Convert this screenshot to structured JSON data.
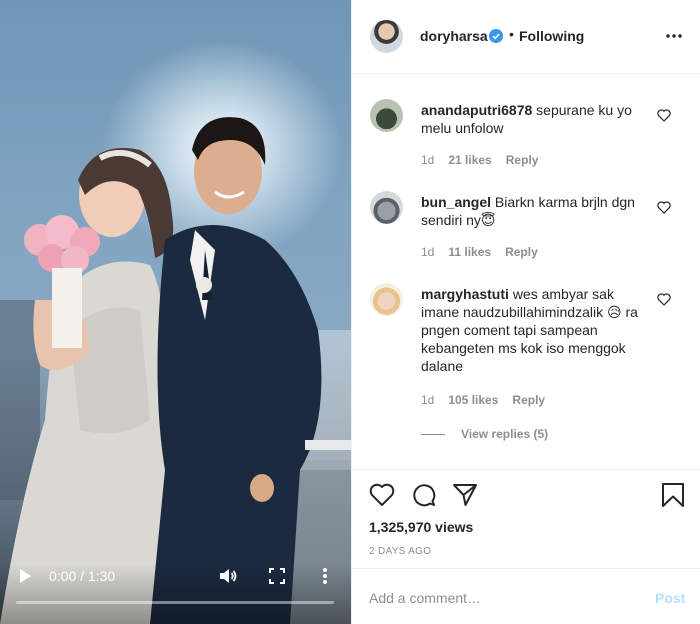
{
  "post": {
    "author": "doryharsa",
    "separator": "•",
    "follow_status": "Following",
    "views": "1,325,970 views",
    "date": "2 DAYS AGO"
  },
  "video": {
    "time": "0:00 / 1:30",
    "progress": 0
  },
  "comments": [
    {
      "username": "anandaputri6878",
      "text": "sepurane ku yo melu unfolow",
      "age": "1d",
      "likes": "21 likes",
      "reply": "Reply"
    },
    {
      "username": "bun_angel",
      "text": "Biarkn karma brjln dgn sendiri ny😇",
      "age": "1d",
      "likes": "11 likes",
      "reply": "Reply"
    },
    {
      "username": "margyhastuti",
      "text": "wes ambyar sak imane naudzubillahimindzalik 😥 ra pngen coment tapi sampean kebangeten ms kok iso menggok dalane",
      "age": "1d",
      "likes": "105 likes",
      "reply": "Reply"
    }
  ],
  "view_replies": "View replies (5)",
  "add_comment": {
    "placeholder": "Add a comment…",
    "post_label": "Post"
  },
  "colors": {
    "verified": "#3897f0",
    "post_disabled": "#b2dffc",
    "secondary_text": "#8e8e8e"
  },
  "icons": [
    "verified-badge-icon",
    "more-options-icon",
    "heart-icon",
    "comment-icon",
    "share-icon",
    "bookmark-icon",
    "play-icon",
    "volume-icon",
    "fullscreen-icon"
  ]
}
